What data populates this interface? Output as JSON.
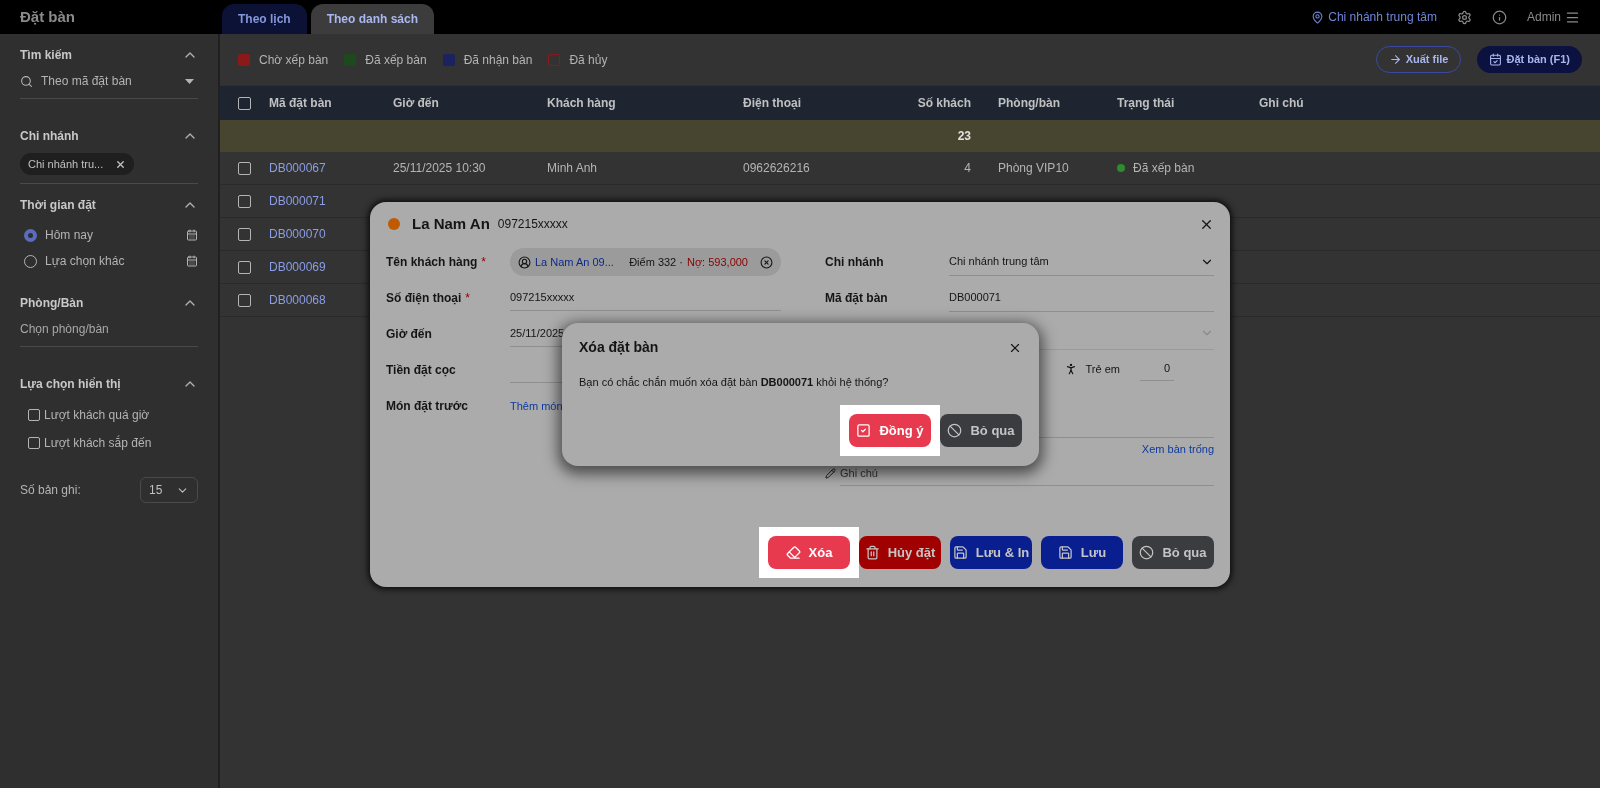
{
  "app_title": "Đặt bàn",
  "view_tabs": [
    {
      "label": "Theo lịch",
      "selected": false
    },
    {
      "label": "Theo danh sách",
      "selected": true
    }
  ],
  "header": {
    "branch": "Chi nhánh trung tâm",
    "user": "Admin"
  },
  "sidebar": {
    "search": {
      "title": "Tìm kiếm",
      "value": "Theo mã đặt bàn"
    },
    "branch": {
      "title": "Chi nhánh",
      "chips": [
        "Chi nhánh tru..."
      ]
    },
    "time": {
      "title": "Thời gian đặt",
      "options": [
        {
          "label": "Hôm nay",
          "selected": true
        },
        {
          "label": "Lựa chọn khác",
          "selected": false
        }
      ]
    },
    "room": {
      "title": "Phòng/Bàn",
      "placeholder": "Chọn phòng/bàn"
    },
    "display": {
      "title": "Lựa chọn hiển thị",
      "options": [
        {
          "label": "Lượt khách quá giờ",
          "checked": false
        },
        {
          "label": "Lượt khách sắp đến",
          "checked": false
        }
      ]
    },
    "records": {
      "label": "Số bản ghi:",
      "value": "15"
    }
  },
  "status_filters": [
    {
      "label": "Chờ xếp bàn",
      "checked": true,
      "color": "#8a1a1a"
    },
    {
      "label": "Đã xếp bàn",
      "checked": true,
      "color": "#1d4a1d"
    },
    {
      "label": "Đã nhận bàn",
      "checked": true,
      "color": "#1a2260"
    },
    {
      "label": "Đã hủy",
      "checked": false,
      "color": "#8a1a1a"
    }
  ],
  "toolbar_buttons": [
    {
      "label": "Xuất file",
      "kind": "outline"
    },
    {
      "label": "Đặt bàn (F1)",
      "kind": "filled"
    }
  ],
  "table": {
    "columns": [
      "Mã đặt bàn",
      "Giờ đến",
      "Khách hàng",
      "Điện thoại",
      "Số khách",
      "Phòng/bàn",
      "Trạng thái",
      "Ghi chú"
    ],
    "all_selected": false,
    "total_guests": "23",
    "rows": [
      {
        "code": "DB000067",
        "time": "25/11/2025 10:30",
        "customer": "Minh Anh",
        "phone": "0962626216",
        "guests": "4",
        "room": "Phòng VIP10",
        "status": "Đã xếp bàn",
        "color": "#2e8b2e",
        "checked": false
      },
      {
        "code": "DB000071",
        "checked": false
      },
      {
        "code": "DB000070",
        "checked": false
      },
      {
        "code": "DB000069",
        "checked": false
      },
      {
        "code": "DB000068",
        "checked": false
      }
    ]
  },
  "booking_dialog": {
    "name": "La Nam An",
    "phone": "097215xxxxx",
    "color": "#c05a00",
    "left_fields": [
      {
        "kind": "customer",
        "label": "Tên khách hàng",
        "required_mark": "*",
        "value": "La Nam An 09...",
        "points": "Điểm 332 ·",
        "debt": "Nợ: 593,000"
      },
      {
        "kind": "text",
        "label": "Số điện thoại",
        "required_mark": "*",
        "value": "097215xxxxx"
      },
      {
        "kind": "text",
        "label": "Giờ đến",
        "value": "25/11/2025"
      },
      {
        "kind": "text",
        "label": "Tiền đặt cọc"
      },
      {
        "kind": "link",
        "label": "Món đặt trước",
        "value": "Thêm món"
      }
    ],
    "branch": {
      "label": "Chi nhánh",
      "value": "Chi nhánh trung tâm"
    },
    "code": {
      "label": "Mã đặt bàn",
      "value": "DB000071"
    },
    "children": {
      "label": "Trẻ em",
      "value": "0"
    },
    "free_tables_link": "Xem bàn trống",
    "note_placeholder": "Ghi chú",
    "buttons": [
      {
        "label": "Xóa",
        "kind": "delete",
        "highlighted": true
      },
      {
        "label": "Hủy đặt",
        "kind": "void",
        "highlighted": false
      },
      {
        "label": "Lưu & In",
        "kind": "save_print",
        "highlighted": false
      },
      {
        "label": "Lưu",
        "kind": "save",
        "highlighted": false
      },
      {
        "label": "Bỏ qua",
        "kind": "dismiss",
        "highlighted": false
      }
    ]
  },
  "confirm_dialog": {
    "title": "Xóa đặt bàn",
    "message": "Bạn có chắc chắn muốn xóa đặt bàn **DB000071** khỏi hệ thống?",
    "buttons": [
      {
        "label": "Đồng ý",
        "kind": "confirm",
        "highlighted": true
      },
      {
        "label": "Bỏ qua",
        "kind": "dismiss",
        "highlighted": false
      }
    ]
  }
}
